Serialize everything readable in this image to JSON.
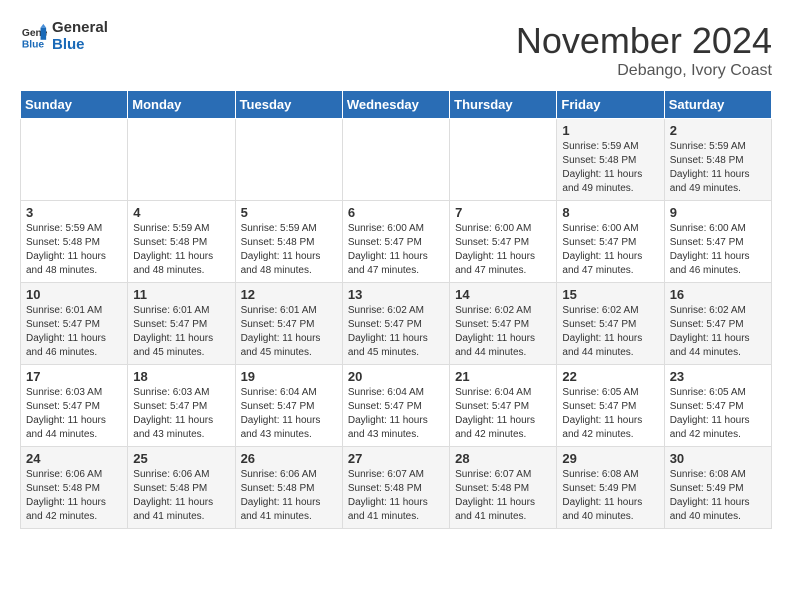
{
  "header": {
    "logo_line1": "General",
    "logo_line2": "Blue",
    "month": "November 2024",
    "location": "Debango, Ivory Coast"
  },
  "weekdays": [
    "Sunday",
    "Monday",
    "Tuesday",
    "Wednesday",
    "Thursday",
    "Friday",
    "Saturday"
  ],
  "weeks": [
    [
      {
        "day": "",
        "info": ""
      },
      {
        "day": "",
        "info": ""
      },
      {
        "day": "",
        "info": ""
      },
      {
        "day": "",
        "info": ""
      },
      {
        "day": "",
        "info": ""
      },
      {
        "day": "1",
        "info": "Sunrise: 5:59 AM\nSunset: 5:48 PM\nDaylight: 11 hours\nand 49 minutes."
      },
      {
        "day": "2",
        "info": "Sunrise: 5:59 AM\nSunset: 5:48 PM\nDaylight: 11 hours\nand 49 minutes."
      }
    ],
    [
      {
        "day": "3",
        "info": "Sunrise: 5:59 AM\nSunset: 5:48 PM\nDaylight: 11 hours\nand 48 minutes."
      },
      {
        "day": "4",
        "info": "Sunrise: 5:59 AM\nSunset: 5:48 PM\nDaylight: 11 hours\nand 48 minutes."
      },
      {
        "day": "5",
        "info": "Sunrise: 5:59 AM\nSunset: 5:48 PM\nDaylight: 11 hours\nand 48 minutes."
      },
      {
        "day": "6",
        "info": "Sunrise: 6:00 AM\nSunset: 5:47 PM\nDaylight: 11 hours\nand 47 minutes."
      },
      {
        "day": "7",
        "info": "Sunrise: 6:00 AM\nSunset: 5:47 PM\nDaylight: 11 hours\nand 47 minutes."
      },
      {
        "day": "8",
        "info": "Sunrise: 6:00 AM\nSunset: 5:47 PM\nDaylight: 11 hours\nand 47 minutes."
      },
      {
        "day": "9",
        "info": "Sunrise: 6:00 AM\nSunset: 5:47 PM\nDaylight: 11 hours\nand 46 minutes."
      }
    ],
    [
      {
        "day": "10",
        "info": "Sunrise: 6:01 AM\nSunset: 5:47 PM\nDaylight: 11 hours\nand 46 minutes."
      },
      {
        "day": "11",
        "info": "Sunrise: 6:01 AM\nSunset: 5:47 PM\nDaylight: 11 hours\nand 45 minutes."
      },
      {
        "day": "12",
        "info": "Sunrise: 6:01 AM\nSunset: 5:47 PM\nDaylight: 11 hours\nand 45 minutes."
      },
      {
        "day": "13",
        "info": "Sunrise: 6:02 AM\nSunset: 5:47 PM\nDaylight: 11 hours\nand 45 minutes."
      },
      {
        "day": "14",
        "info": "Sunrise: 6:02 AM\nSunset: 5:47 PM\nDaylight: 11 hours\nand 44 minutes."
      },
      {
        "day": "15",
        "info": "Sunrise: 6:02 AM\nSunset: 5:47 PM\nDaylight: 11 hours\nand 44 minutes."
      },
      {
        "day": "16",
        "info": "Sunrise: 6:02 AM\nSunset: 5:47 PM\nDaylight: 11 hours\nand 44 minutes."
      }
    ],
    [
      {
        "day": "17",
        "info": "Sunrise: 6:03 AM\nSunset: 5:47 PM\nDaylight: 11 hours\nand 44 minutes."
      },
      {
        "day": "18",
        "info": "Sunrise: 6:03 AM\nSunset: 5:47 PM\nDaylight: 11 hours\nand 43 minutes."
      },
      {
        "day": "19",
        "info": "Sunrise: 6:04 AM\nSunset: 5:47 PM\nDaylight: 11 hours\nand 43 minutes."
      },
      {
        "day": "20",
        "info": "Sunrise: 6:04 AM\nSunset: 5:47 PM\nDaylight: 11 hours\nand 43 minutes."
      },
      {
        "day": "21",
        "info": "Sunrise: 6:04 AM\nSunset: 5:47 PM\nDaylight: 11 hours\nand 42 minutes."
      },
      {
        "day": "22",
        "info": "Sunrise: 6:05 AM\nSunset: 5:47 PM\nDaylight: 11 hours\nand 42 minutes."
      },
      {
        "day": "23",
        "info": "Sunrise: 6:05 AM\nSunset: 5:47 PM\nDaylight: 11 hours\nand 42 minutes."
      }
    ],
    [
      {
        "day": "24",
        "info": "Sunrise: 6:06 AM\nSunset: 5:48 PM\nDaylight: 11 hours\nand 42 minutes."
      },
      {
        "day": "25",
        "info": "Sunrise: 6:06 AM\nSunset: 5:48 PM\nDaylight: 11 hours\nand 41 minutes."
      },
      {
        "day": "26",
        "info": "Sunrise: 6:06 AM\nSunset: 5:48 PM\nDaylight: 11 hours\nand 41 minutes."
      },
      {
        "day": "27",
        "info": "Sunrise: 6:07 AM\nSunset: 5:48 PM\nDaylight: 11 hours\nand 41 minutes."
      },
      {
        "day": "28",
        "info": "Sunrise: 6:07 AM\nSunset: 5:48 PM\nDaylight: 11 hours\nand 41 minutes."
      },
      {
        "day": "29",
        "info": "Sunrise: 6:08 AM\nSunset: 5:49 PM\nDaylight: 11 hours\nand 40 minutes."
      },
      {
        "day": "30",
        "info": "Sunrise: 6:08 AM\nSunset: 5:49 PM\nDaylight: 11 hours\nand 40 minutes."
      }
    ]
  ]
}
